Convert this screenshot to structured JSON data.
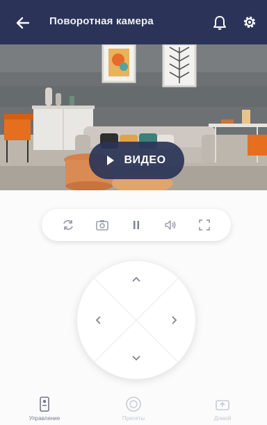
{
  "header": {
    "title": "Поворотная камера",
    "bg_color": "#2b3458"
  },
  "video": {
    "play_label": "ВИДЕО"
  },
  "toolbar": {
    "icons": [
      "rotate-icon",
      "snapshot-icon",
      "pause-icon",
      "volume-icon",
      "fullscreen-icon"
    ]
  },
  "dpad": {
    "icons": [
      "chevron-up-icon",
      "chevron-left-icon",
      "chevron-right-icon",
      "chevron-down-icon"
    ]
  },
  "tabs": [
    {
      "label": "Управление",
      "icon": "remote-icon",
      "active": true
    },
    {
      "label": "Пресеты",
      "icon": "preset-icon",
      "active": false
    },
    {
      "label": "Домой",
      "icon": "home-icon",
      "active": false
    }
  ]
}
